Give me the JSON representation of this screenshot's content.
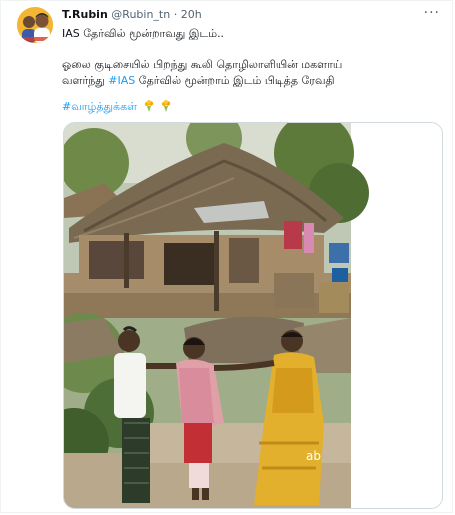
{
  "tweet": {
    "author_name": "T.Rubin",
    "author_handle": "@Rubin_tn",
    "separator": "·",
    "time": "20h",
    "more_label": "···",
    "line1": "IAS தேர்வில் மூன்றாவது இடம்..",
    "line2": "ஓலை குடிசையில் பிறந்து கூலி தொழிலாளியின் மகளாய்",
    "line3_before": "வளர்ந்து ",
    "line3_hashtag": "#IAS",
    "line3_after": " தேர்வில் மூன்றாம் இடம் பிடித்த ரேவதி",
    "hashtag2": "#வாழ்த்துக்கள்"
  },
  "media": {
    "watermark": "ab"
  },
  "icons": {
    "more": "more-dots-icon",
    "flower": "bouquet-emoji-icon"
  },
  "colors": {
    "link": "#1d9bf0",
    "secondary_text": "#536471",
    "border": "#cfd9de"
  }
}
